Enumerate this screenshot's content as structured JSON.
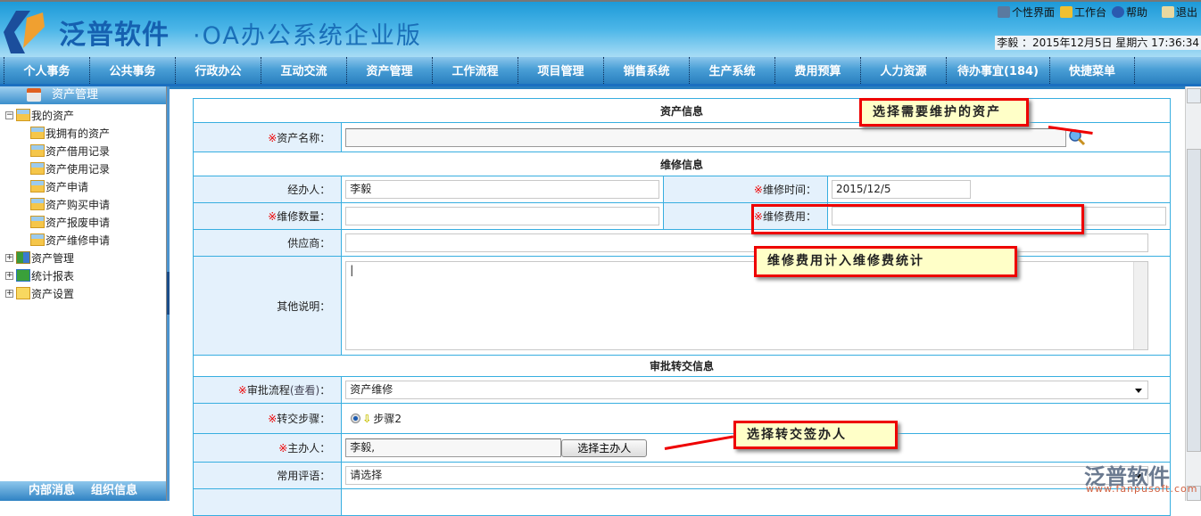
{
  "header": {
    "brand": "泛普软件",
    "subtitle": "·OA办公系统企业版",
    "top_links": [
      "个性界面",
      "工作台",
      "帮助",
      "退出"
    ],
    "user_info": "李毅 ：2015年12月5日 星期六 17:36:34"
  },
  "nav": [
    "个人事务",
    "公共事务",
    "行政办公",
    "互动交流",
    "资产管理",
    "工作流程",
    "项目管理",
    "销售系统",
    "生产系统",
    "费用预算",
    "人力资源",
    "待办事宜(184)",
    "快捷菜单"
  ],
  "sidebar": {
    "title": "资产管理",
    "tree": {
      "root": "我的资产",
      "children": [
        "我拥有的资产",
        "资产借用记录",
        "资产使用记录",
        "资产申请",
        "资产购买申请",
        "资产报废申请",
        "资产维修申请"
      ],
      "others": [
        "资产管理",
        "统计报表",
        "资产设置"
      ]
    },
    "bottom": [
      "内部消息",
      "组织信息"
    ]
  },
  "form": {
    "sec_asset": "资产信息",
    "asset_name_label": "资产名称：",
    "asset_name": "",
    "sec_repair": "维修信息",
    "handler_label": "经办人：",
    "handler": "李毅",
    "repair_time_label": "维修时间：",
    "repair_time": "2015/12/5",
    "qty_label": "维修数量：",
    "qty": "",
    "cost_label": "维修费用：",
    "cost": "",
    "supplier_label": "供应商：",
    "supplier": "",
    "note_label": "其他说明：",
    "note": "",
    "sec_approval": "审批转交信息",
    "flow_label": "审批流程",
    "flow_view": "(查看)",
    "flow_colon": "：",
    "flow": "资产维修",
    "step_label": "转交步骤：",
    "step": "步骤2",
    "owner_label": "主办人：",
    "owner": "李毅,",
    "owner_button": "选择主办人",
    "comment_label": "常用评语：",
    "comment": "请选择",
    "req_mark": "※"
  },
  "callouts": {
    "asset": "选择需要维护的资产",
    "cost": "维修费用计入维修费统计",
    "owner": "选择转交签办人"
  },
  "watermark": {
    "brand": "泛普软件",
    "url": "www.fanpusoft.com"
  }
}
